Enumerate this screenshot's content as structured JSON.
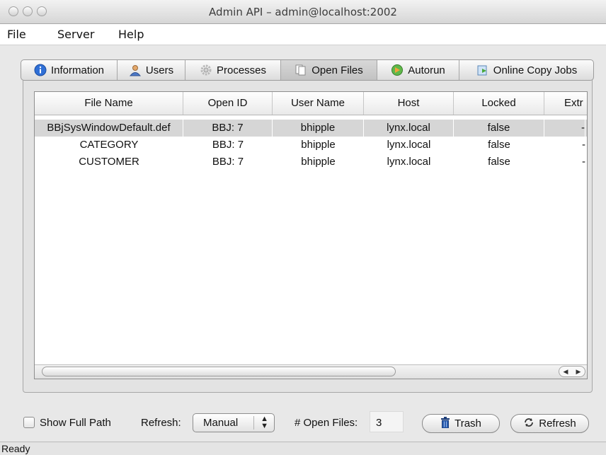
{
  "window": {
    "title": "Admin API – admin@localhost:2002"
  },
  "menu": {
    "items": [
      "File",
      "Server",
      "Help"
    ]
  },
  "tabs": [
    {
      "label": "Information",
      "icon": "info-icon",
      "active": false
    },
    {
      "label": "Users",
      "icon": "users-icon",
      "active": false
    },
    {
      "label": "Processes",
      "icon": "gear-icon",
      "active": false
    },
    {
      "label": "Open Files",
      "icon": "documents-icon",
      "active": true
    },
    {
      "label": "Autorun",
      "icon": "autorun-icon",
      "active": false
    },
    {
      "label": "Online Copy Jobs",
      "icon": "copy-jobs-icon",
      "active": false
    }
  ],
  "table": {
    "columns": [
      "File Name",
      "Open ID",
      "User Name",
      "Host",
      "Locked",
      "Extr"
    ],
    "rows": [
      [
        "BBjSysWindowDefault.def",
        "BBJ: 7",
        "bhipple",
        "lynx.local",
        "false",
        "-"
      ],
      [
        "CATEGORY",
        "BBJ: 7",
        "bhipple",
        "lynx.local",
        "false",
        "-"
      ],
      [
        "CUSTOMER",
        "BBJ: 7",
        "bhipple",
        "lynx.local",
        "false",
        "-"
      ]
    ],
    "selected_row": 0
  },
  "controls": {
    "show_full_path_label": "Show Full Path",
    "show_full_path_checked": false,
    "refresh_label": "Refresh:",
    "refresh_value": "Manual",
    "open_files_label": "# Open Files:",
    "open_files_count": "3",
    "trash_label": "Trash",
    "refresh_button_label": "Refresh"
  },
  "status": "Ready",
  "colors": {
    "selected_row": "#d6d6d6",
    "window_bg": "#e8e8e8"
  }
}
